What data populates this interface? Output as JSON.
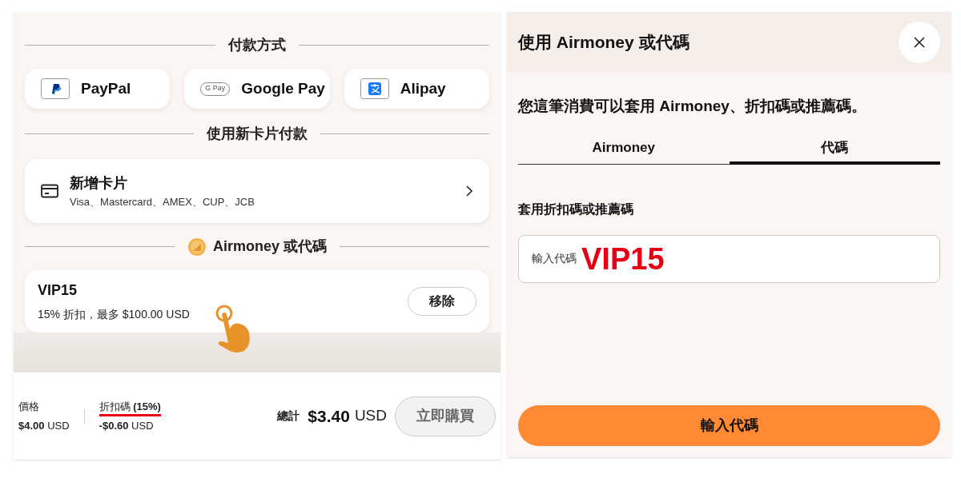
{
  "checkout": {
    "payment_heading": "付款方式",
    "wallets": [
      {
        "kind": "paypal",
        "label": "PayPal"
      },
      {
        "kind": "gpay",
        "label": "Google Pay",
        "logo_text": "G Pay"
      },
      {
        "kind": "alipay",
        "label": "Alipay"
      }
    ],
    "new_card_heading": "使用新卡片付款",
    "new_card": {
      "title": "新增卡片",
      "subtitle": "Visa、Mastercard、AMEX、CUP、JCB"
    },
    "code_heading": "Airmoney 或代碼",
    "applied_code": {
      "code": "VIP15",
      "description": "15% 折扣，最多 $100.00 USD",
      "button": "移除"
    },
    "summary": [
      {
        "label": "價格",
        "amount": "**$4.00** USD",
        "highlighted": false
      },
      {
        "label": "折扣碼 **(15%)**",
        "amount": "**-$0.60** USD",
        "highlighted": true
      }
    ],
    "total_label": "總計",
    "total_amount": "$3.40",
    "total_currency": "USD",
    "buy_button": {
      "label": "立即購買",
      "disabled": true
    }
  },
  "dialog": {
    "title": "使用 Airmoney 或代碼",
    "intro": "您這筆消費可以套用 Airmoney、折扣碼或推薦碼。",
    "tabs": [
      {
        "label": "Airmoney",
        "selected": false
      },
      {
        "label": "代碼",
        "selected": true
      }
    ],
    "field_heading": "套用折扣碼或推薦碼",
    "field": {
      "placeholder": "輸入代碼",
      "value": "VIP15"
    },
    "submit": "輸入代碼"
  }
}
